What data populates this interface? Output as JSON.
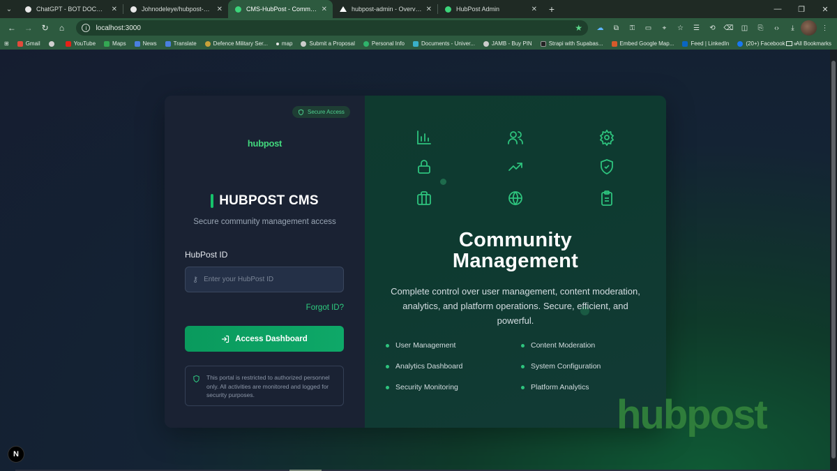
{
  "browser": {
    "tabs": [
      {
        "title": "ChatGPT - BOT DOCUMENT",
        "color": "#ffffff",
        "active": false
      },
      {
        "title": "Johnodeleye/hubpost-admin",
        "color": "#ffffff",
        "active": false
      },
      {
        "title": "CMS-HubPost - Community Ma",
        "color": "#3cd47a",
        "active": true
      },
      {
        "title": "hubpost-admin - Overview – Ve",
        "color": "#ffffff",
        "active": false
      },
      {
        "title": "HubPost Admin",
        "color": "#3cd47a",
        "active": false
      }
    ],
    "url": "localhost:3000",
    "bookmarks": [
      {
        "label": "Gmail",
        "color": "#e24a3b"
      },
      {
        "label": "YouTube",
        "color": "#e62117"
      },
      {
        "label": "Maps",
        "color": "#34a853"
      },
      {
        "label": "News",
        "color": "#4a7fe0"
      },
      {
        "label": "Translate",
        "color": "#4a7fe0"
      },
      {
        "label": "Defence Military Ser...",
        "color": "#c9a13a"
      },
      {
        "label": "map",
        "color": "#e6e6e6"
      },
      {
        "label": "Submit a Proposal",
        "color": "#cccccc"
      },
      {
        "label": "Personal Info",
        "color": "#2fb36b"
      },
      {
        "label": "Documents - Univer...",
        "color": "#3ab0c8"
      },
      {
        "label": "JAMB - Buy PIN",
        "color": "#cccccc"
      },
      {
        "label": "Strapi with Supabas...",
        "color": "#222222"
      },
      {
        "label": "Embed Google Map...",
        "color": "#d65a2b"
      },
      {
        "label": "Feed | LinkedIn",
        "color": "#0a66c2"
      },
      {
        "label": "(20+) Facebook",
        "color": "#1877f2"
      }
    ],
    "all_bookmarks": "All Bookmarks"
  },
  "login": {
    "badge": "Secure Access",
    "logo": "hubpost",
    "title": "HUBPOST CMS",
    "subtitle": "Secure community management access",
    "id_label": "HubPost ID",
    "id_placeholder": "Enter your HubPost ID",
    "forgot": "Forgot ID?",
    "button": "Access Dashboard",
    "notice": "This portal is restricted to authorized personnel only. All activities are monitored and logged for security purposes."
  },
  "promo": {
    "title_line1": "Community",
    "title_line2": "Management",
    "description": "Complete control over user management, content moderation, analytics, and platform operations. Secure, efficient, and powerful.",
    "features": [
      "User Management",
      "Content Moderation",
      "Analytics Dashboard",
      "System Configuration",
      "Security Monitoring",
      "Platform Analytics"
    ],
    "icons": [
      "bar-chart-icon",
      "users-icon",
      "gear-icon",
      "lock-icon",
      "trending-up-icon",
      "shield-check-icon",
      "briefcase-icon",
      "globe-icon",
      "clipboard-icon"
    ]
  },
  "watermark": "hubpost",
  "next_badge": "N",
  "accent": "#16c26b"
}
